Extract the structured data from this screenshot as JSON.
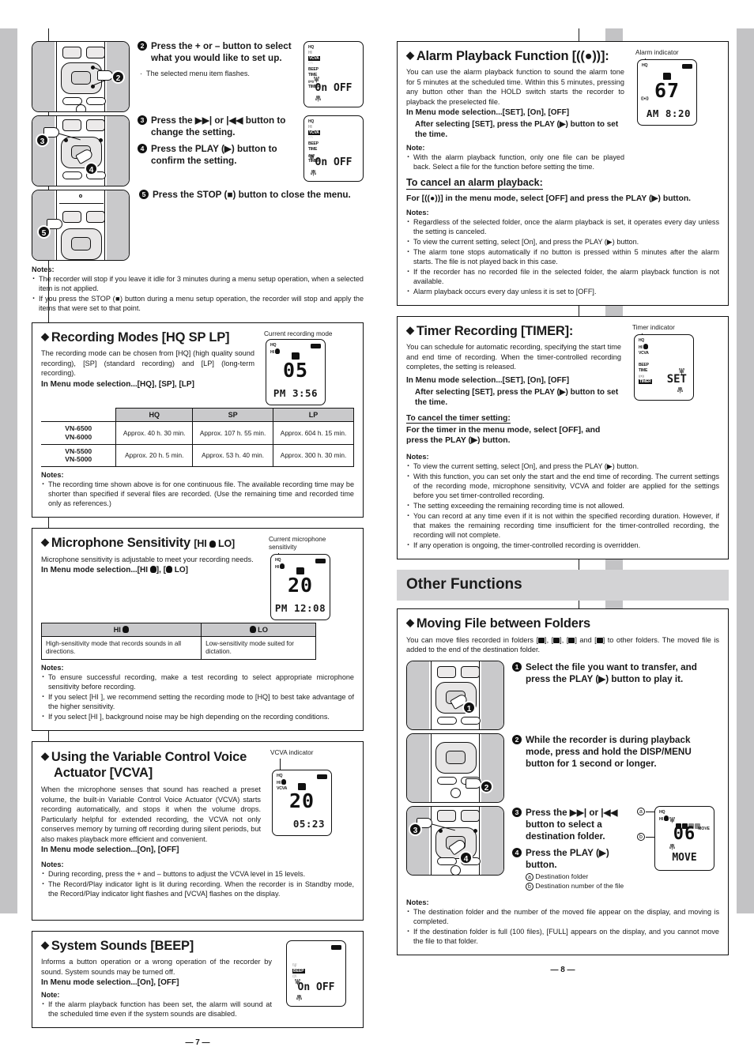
{
  "document": {
    "left_page_number": "— 7 —",
    "right_page_number": "— 8 —"
  },
  "left_page": {
    "steps": [
      {
        "num": "2",
        "text": "Press the + or – button to select what you would like to set up.",
        "sub": "The selected menu item flashes.",
        "lcd": {
          "menu_items": [
            "HQ",
            "HI",
            "VCVA",
            "BEEP",
            "TIME",
            "Alarm",
            "TIMER"
          ],
          "flashing_item": "VCVA",
          "value": "On OFF",
          "flashing": true
        }
      },
      {
        "num": "3",
        "text": "Press the ▶▶| or |◀◀ button to change the setting."
      },
      {
        "num": "4",
        "text": "Press the PLAY (▶) button to confirm the setting.",
        "lcd": {
          "menu_items": [
            "HQ",
            "HI",
            "VCVA",
            "BEEP",
            "TIME",
            "Alarm",
            "TIMER"
          ],
          "flashing_item": "VCVA",
          "value": "On OFF",
          "flashing": true
        }
      },
      {
        "num": "5",
        "text": "Press the STOP (■) button to close the menu."
      }
    ],
    "step_notes_head": "Notes:",
    "step_notes": [
      "The recorder will stop if you leave it idle for 3 minutes during a menu setup operation, when a selected item is not applied.",
      "If you press the STOP (■) button during a menu setup operation, the recorder will stop and apply the items that were set to that point."
    ],
    "recording_modes": {
      "title": "Recording Modes [HQ SP LP]",
      "body": "The recording mode can be chosen from [HQ] (high quality sound recording), [SP] (standard recording) and [LP] (long-term recording).",
      "menu_line": "In Menu mode selection...[HQ], [SP], [LP]",
      "caption": "Current recording mode",
      "lcd": {
        "indicators": [
          "HQ",
          "HI"
        ],
        "mode_flag": "HQ",
        "file_number": "05",
        "time": "PM 3:56",
        "battery": true
      },
      "table": {
        "columns": [
          "HQ",
          "SP",
          "LP"
        ],
        "rows": [
          {
            "models": [
              "VN-6500",
              "VN-6000"
            ],
            "values": [
              "Approx. 40 h. 30 min.",
              "Approx. 107 h. 55 min.",
              "Approx. 604 h. 15 min."
            ]
          },
          {
            "models": [
              "VN-5500",
              "VN-5000"
            ],
            "values": [
              "Approx. 20 h. 5 min.",
              "Approx. 53 h. 40 min.",
              "Approx. 300 h. 30 min."
            ]
          }
        ]
      },
      "notes_head": "Notes:",
      "notes": [
        "The recording time shown above is for one continuous file. The available recording time may be shorter than specified if several files are recorded. (Use the remaining time and recorded time only as references.)"
      ]
    },
    "mic_sensitivity": {
      "title": "Microphone Sensitivity [HI   LO]",
      "body": "Microphone sensitivity is adjustable to meet your recording needs.",
      "menu_line": "In Menu mode selection...[HI  ], [  LO]",
      "caption": "Current microphone sensitivity",
      "lcd": {
        "indicators": [
          "HQ",
          "HI"
        ],
        "file_number": "20",
        "time": "PM 12:08",
        "battery": true
      },
      "table": {
        "columns": [
          "HI",
          "LO"
        ],
        "cells": [
          "High-sensitivity mode that records sounds in all directions.",
          "Low-sensitivity mode suited for dictation."
        ]
      },
      "notes_head": "Notes:",
      "notes": [
        "To ensure successful recording, make a test recording to select appropriate microphone sensitivity before recording.",
        "If you select [HI  ], we recommend setting the recording mode to [HQ] to best take advantage of the higher sensitivity.",
        "If you select [HI  ], background noise may be high depending on the recording conditions."
      ]
    },
    "vcva": {
      "title_line1": "Using the Variable Control Voice",
      "title_line2": "Actuator [VCVA]",
      "body": "When the microphone senses that sound has reached a preset volume, the built-in Variable Control Voice Actuator (VCVA) starts recording automatically, and stops it when the volume drops. Particularly helpful for extended recording, the VCVA not only conserves memory by turning off recording during silent periods, but also makes playback more efficient and convenient.",
      "menu_line": "In Menu mode selection...[On], [OFF]",
      "caption": "VCVA indicator",
      "lcd": {
        "indicators": [
          "HQ",
          "HI",
          "VCVA"
        ],
        "file_number": "20",
        "time": "05:23",
        "battery": true
      },
      "notes_head": "Notes:",
      "notes": [
        "During recording, press the + and – buttons to adjust the VCVA level in 15 levels.",
        "The Record/Play indicator light is lit during recording. When the recorder is in Standby mode, the Record/Play indicator light flashes and [VCVA] flashes on the display."
      ]
    },
    "system_sounds": {
      "title": "System Sounds [BEEP]",
      "body": "Informs a button operation or a wrong operation of the recorder by sound. System sounds may be turned off.",
      "menu_line": "In Menu mode selection...[On], [OFF]",
      "notes_head": "Note:",
      "notes": [
        "If the alarm playback function has been set, the alarm will sound at the scheduled time even if the system sounds are disabled."
      ],
      "lcd": {
        "menu_items": [
          "HQ",
          "HI",
          "VCVA",
          "BEEP",
          "TIME",
          "Alarm",
          "TIMER"
        ],
        "flashing_item": "BEEP",
        "value": "On OFF",
        "battery": true
      }
    }
  },
  "right_page": {
    "alarm": {
      "title": "Alarm Playback Function [((●))]:",
      "body": "You can use the alarm playback function to sound the alarm tone for 5 minutes at the scheduled time. Within this 5 minutes, pressing any button other than the HOLD switch starts the recorder to playback the preselected file.",
      "menu_line": "In Menu mode selection...[SET], [On], [OFF]",
      "menu_sub": "After selecting [SET], press the PLAY (▶) button to set the time.",
      "caption": "Alarm indicator",
      "lcd": {
        "indicators": [
          "HQ"
        ],
        "file_number": "67",
        "time": "AM 8:20",
        "battery": true,
        "alarm_icon": true
      },
      "note_head": "Note:",
      "note": [
        "With the alarm playback function, only one file can be played back. Select a file for the function before setting the time."
      ],
      "cancel_head": "To cancel an alarm playback:",
      "cancel_line": "For [((●))] in the menu mode, select [OFF] and press the PLAY (▶) button.",
      "notes_head": "Notes:",
      "notes": [
        "Regardless of the selected folder, once the alarm playback is set, it operates every day unless the setting is canceled.",
        "To view the current setting, select [On], and press the PLAY (▶) button.",
        "The alarm tone stops automatically if no button is pressed within 5 minutes after the alarm starts. The file is not played back in this case.",
        "If the recorder has no recorded file in the selected folder, the alarm playback function is not available.",
        "Alarm playback occurs every day unless it is set to [OFF]."
      ]
    },
    "timer": {
      "title": "Timer Recording [TIMER]:",
      "body": "You can schedule for automatic recording, specifying the start time and end time of recording. When the timer-controlled recording completes, the setting is released.",
      "menu_line": "In Menu mode selection...[SET], [On], [OFF]",
      "menu_sub": "After selecting [SET], press the PLAY (▶) button to set the time.",
      "caption": "Timer indicator",
      "lcd": {
        "menu_items": [
          "HQ",
          "HI",
          "VCVA",
          "BEEP",
          "TIME",
          "Alarm",
          "TIMER"
        ],
        "flashing_item": "TIMER",
        "value": "SET",
        "flashing": true
      },
      "cancel_head": "To cancel the timer setting:",
      "cancel_line": "For the timer in the menu mode, select [OFF], and press the PLAY (▶) button.",
      "notes_head": "Notes:",
      "notes": [
        "To view the current setting, select [On], and press the PLAY (▶) button.",
        "With this function, you can set only the start and the end time of recording. The current settings of the recording mode, microphone sensitivity, VCVA and folder are applied for the settings before you set timer-controlled recording.",
        "The setting exceeding the remaining recording time is not allowed.",
        "You can record at any time even if it is not within the specified recording duration. However, if that makes the remaining recording time insufficient for the timer-controlled recording, the recording will not complete.",
        "If any operation is ongoing, the timer-controlled recording is overridden."
      ]
    },
    "other_functions_banner": "Other Functions",
    "moving_file": {
      "title": "Moving File between Folders",
      "body": "You can move files recorded in folders [ ], [ ], [ ] and [ ] to other folders. The moved file is added to the end of the destination folder.",
      "steps": [
        {
          "num": "1",
          "text": "Select the file you want to transfer, and press the PLAY (▶) button to play it."
        },
        {
          "num": "2",
          "text": "While the recorder is during playback mode, press and hold the DISP/MENU button for 1 second or longer."
        },
        {
          "num": "3",
          "text": "Press the ▶▶| or |◀◀ button to select a destination folder."
        },
        {
          "num": "4",
          "text": "Press the PLAY (▶) button."
        }
      ],
      "legend": [
        {
          "key": "a",
          "text": "Destination folder"
        },
        {
          "key": "b",
          "text": "Destination number of the file"
        }
      ],
      "lcd": {
        "indicators": [
          "HQ",
          "HI"
        ],
        "file_number": "06",
        "word": "MOVE",
        "move_label": "MOVE"
      },
      "notes_head": "Notes:",
      "notes": [
        "The destination folder and the number of the moved file appear on the display, and moving is completed.",
        "If the destination folder is full (100 files), [FULL] appears on the display, and you cannot move the file to that folder."
      ]
    }
  }
}
